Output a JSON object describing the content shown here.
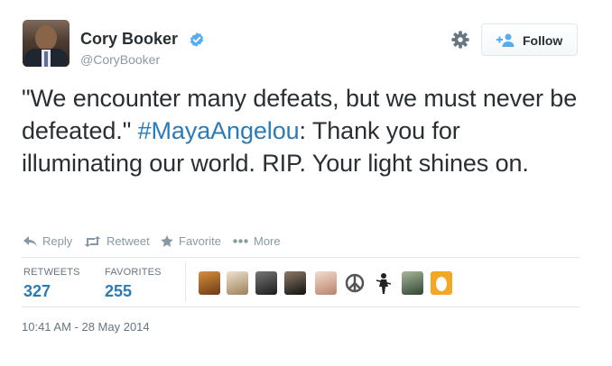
{
  "user": {
    "name": "Cory Booker",
    "handle": "@CoryBooker",
    "verified": true
  },
  "header": {
    "follow_label": "Follow"
  },
  "tweet": {
    "text_before": "\"We encounter many defeats, but we must never be defeated.\" ",
    "hashtag": "#MayaAngelou",
    "text_after": ": Thank you for illuminating our world. RIP. Your light shines on."
  },
  "actions": [
    {
      "label": "Reply",
      "icon": "reply-icon"
    },
    {
      "label": "Retweet",
      "icon": "retweet-icon"
    },
    {
      "label": "Favorite",
      "icon": "star-icon"
    },
    {
      "label": "More",
      "icon": "more-icon"
    }
  ],
  "stats": {
    "retweets_label": "RETWEETS",
    "retweets_count": "327",
    "favorites_label": "FAVORITES",
    "favorites_count": "255"
  },
  "favoriters": [
    {
      "icon": "favoriter-avatar-1",
      "color": "#b06a2c"
    },
    {
      "icon": "favoriter-avatar-2",
      "color": "#c9b48f"
    },
    {
      "icon": "favoriter-avatar-3",
      "color": "#3a3a3a"
    },
    {
      "icon": "favoriter-avatar-4",
      "color": "#2a2a2a"
    },
    {
      "icon": "favoriter-avatar-5",
      "color": "#d7b7a2"
    },
    {
      "icon": "peace-sign-avatar",
      "color": "#555555"
    },
    {
      "icon": "favoriter-avatar-7",
      "color": "#222222"
    },
    {
      "icon": "favoriter-avatar-8",
      "color": "#4f6a55"
    },
    {
      "icon": "default-egg-avatar",
      "color": "#f5a623"
    }
  ],
  "timestamp": "10:41 AM - 28 May 2014",
  "colors": {
    "link": "#2b7bb9",
    "muted": "#8899a6",
    "text": "#292f33",
    "verified": "#55acee"
  }
}
